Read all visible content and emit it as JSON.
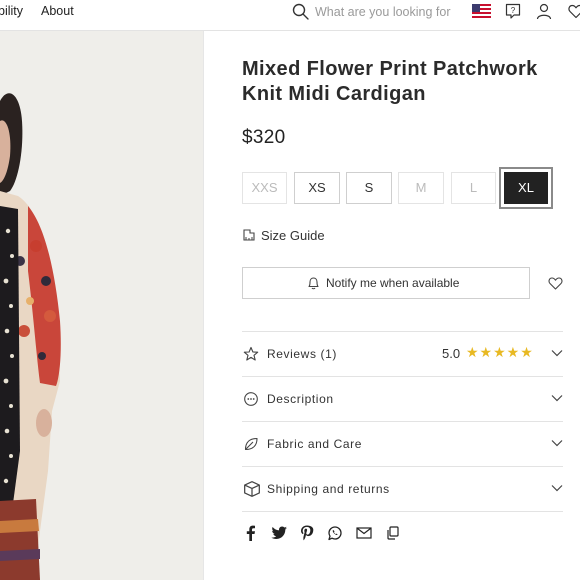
{
  "nav": {
    "items": [
      "bility",
      "About"
    ],
    "search_placeholder": "What are you looking for"
  },
  "product": {
    "title_line1": "Mixed Flower Print Patchwork",
    "title_line2": "Knit Midi Cardigan",
    "price": "$320",
    "sizes": [
      {
        "label": "XXS",
        "available": false,
        "selected": false
      },
      {
        "label": "XS",
        "available": true,
        "selected": false
      },
      {
        "label": "S",
        "available": true,
        "selected": false
      },
      {
        "label": "M",
        "available": false,
        "selected": false
      },
      {
        "label": "L",
        "available": false,
        "selected": false
      },
      {
        "label": "XL",
        "available": true,
        "selected": true
      }
    ],
    "size_guide_label": "Size Guide",
    "notify_label": "Notify me when available"
  },
  "accordion": {
    "reviews_label": "Reviews (1)",
    "rating": "5.0",
    "stars": "★★★★★",
    "star_count": 5,
    "description_label": "Description",
    "fabric_label": "Fabric and Care",
    "shipping_label": "Shipping and returns"
  },
  "share": [
    "facebook-icon",
    "twitter-icon",
    "pinterest-icon",
    "whatsapp-icon",
    "email-icon",
    "copy-link-icon"
  ],
  "colors": {
    "star": "#e8b923",
    "selected_size_bg": "#222222",
    "border": "#cfcfcf",
    "flag_red": "#c8102e",
    "flag_blue": "#3c3b6e"
  }
}
